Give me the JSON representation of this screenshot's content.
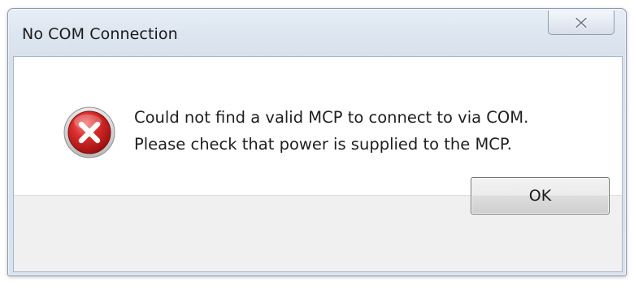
{
  "dialog": {
    "title": "No COM Connection",
    "icon": "error-icon",
    "message_lines": [
      "Could not find a valid MCP to connect to via COM.",
      "Please check that power is supplied to the MCP."
    ],
    "ok_label": "OK",
    "close_icon": "close-icon"
  },
  "colors": {
    "error_red": "#cc1f1f",
    "title_bar": "#dde6f0",
    "button_face": "#e5e5e5"
  }
}
